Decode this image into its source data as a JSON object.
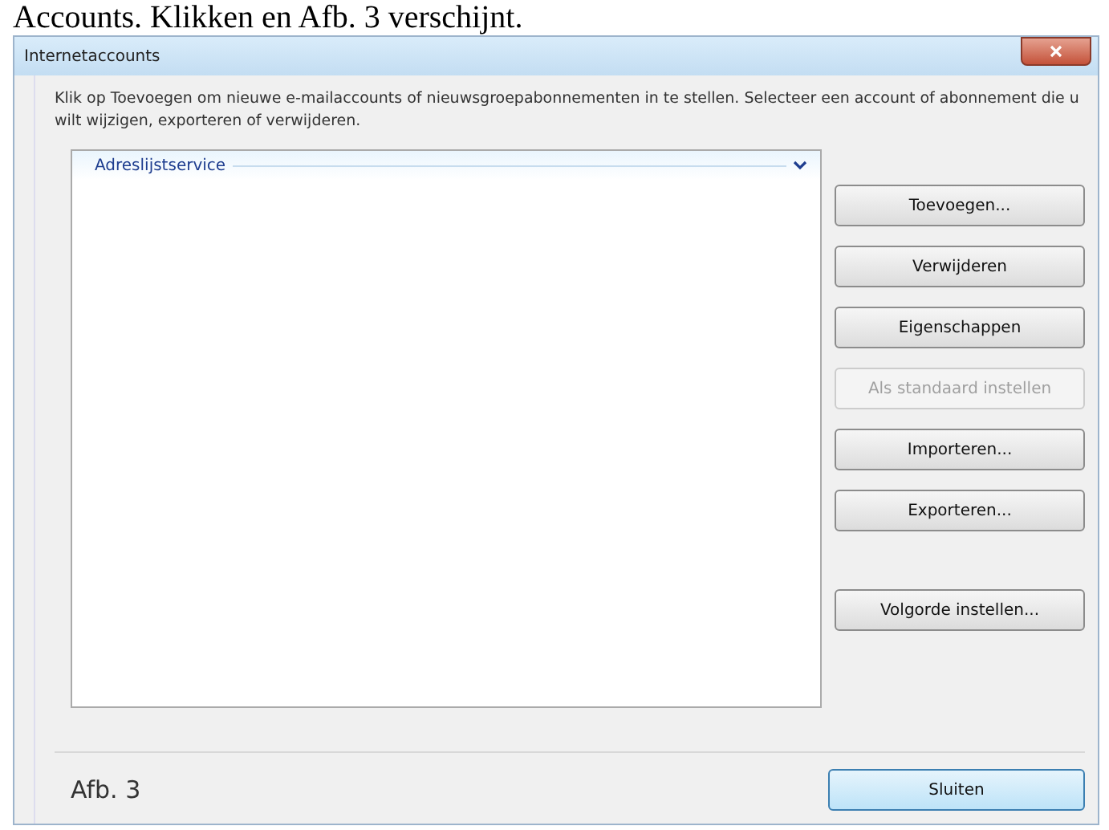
{
  "heading": "Accounts. Klikken en Afb. 3 verschijnt.",
  "window": {
    "title": "Internetaccounts"
  },
  "instructions": "Klik op Toevoegen om nieuwe e-mailaccounts of nieuwsgroepabonnementen in te stellen. Selecteer een account of abonnement die u wilt wijzigen, exporteren of verwijderen.",
  "list": {
    "group_header": "Adreslijstservice",
    "expanded": true
  },
  "buttons": [
    {
      "label": "Toevoegen...",
      "disabled": false
    },
    {
      "label": "Verwijderen",
      "disabled": false
    },
    {
      "label": "Eigenschappen",
      "disabled": false
    },
    {
      "label": "Als standaard instellen",
      "disabled": true
    },
    {
      "label": "Importeren...",
      "disabled": false
    },
    {
      "label": "Exporteren...",
      "disabled": false
    }
  ],
  "order_button": {
    "label": "Volgorde instellen..."
  },
  "caption": "Afb. 3",
  "close_button": {
    "label": "Sluiten",
    "default": true
  }
}
